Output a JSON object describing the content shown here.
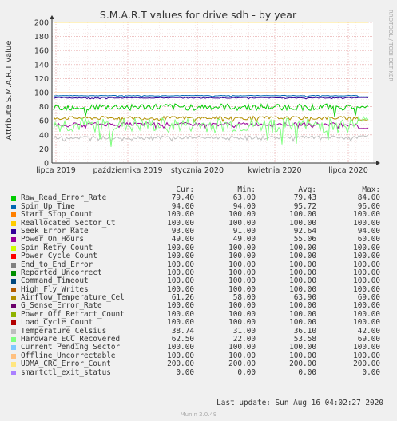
{
  "chart_data": {
    "type": "line",
    "title": "S.M.A.R.T values for drive sdh - by year",
    "ylabel": "Attribute S.M.A.R.T value",
    "side_label": "RRDTOOL / TOBI OETIKER",
    "ylim": [
      0,
      200
    ],
    "yticks": [
      "0",
      "20",
      "40",
      "60",
      "80",
      "100",
      "120",
      "140",
      "160",
      "180",
      "200"
    ],
    "xticks": [
      "lipca 2019",
      "października 2019",
      "stycznia 2020",
      "kwietnia 2020",
      "lipca 2020"
    ],
    "grid": true,
    "columns": [
      "Cur:",
      "Min:",
      "Avg:",
      "Max:"
    ],
    "series": [
      {
        "name": "Raw_Read_Error_Rate",
        "color": "#00cc00",
        "cur": "79.40",
        "min": "63.00",
        "avg": "79.43",
        "max": "84.00"
      },
      {
        "name": "Spin_Up_Time",
        "color": "#0066b3",
        "cur": "94.00",
        "min": "94.00",
        "avg": "95.72",
        "max": "96.00"
      },
      {
        "name": "Start_Stop_Count",
        "color": "#ff8000",
        "cur": "100.00",
        "min": "100.00",
        "avg": "100.00",
        "max": "100.00"
      },
      {
        "name": "Reallocated_Sector_Ct",
        "color": "#ffcc00",
        "cur": "100.00",
        "min": "100.00",
        "avg": "100.00",
        "max": "100.00"
      },
      {
        "name": "Seek_Error_Rate",
        "color": "#330099",
        "cur": "93.00",
        "min": "91.00",
        "avg": "92.64",
        "max": "94.00"
      },
      {
        "name": "Power_On_Hours",
        "color": "#990099",
        "cur": "49.00",
        "min": "49.00",
        "avg": "55.06",
        "max": "60.00"
      },
      {
        "name": "Spin_Retry_Count",
        "color": "#ccff00",
        "cur": "100.00",
        "min": "100.00",
        "avg": "100.00",
        "max": "100.00"
      },
      {
        "name": "Power_Cycle_Count",
        "color": "#ff0000",
        "cur": "100.00",
        "min": "100.00",
        "avg": "100.00",
        "max": "100.00"
      },
      {
        "name": "End_to_End_Error",
        "color": "#808080",
        "cur": "100.00",
        "min": "100.00",
        "avg": "100.00",
        "max": "100.00"
      },
      {
        "name": "Reported_Uncorrect",
        "color": "#008f00",
        "cur": "100.00",
        "min": "100.00",
        "avg": "100.00",
        "max": "100.00"
      },
      {
        "name": "Command_Timeout",
        "color": "#00487d",
        "cur": "100.00",
        "min": "100.00",
        "avg": "100.00",
        "max": "100.00"
      },
      {
        "name": "High_Fly_Writes",
        "color": "#b35a00",
        "cur": "100.00",
        "min": "100.00",
        "avg": "100.00",
        "max": "100.00"
      },
      {
        "name": "Airflow_Temperature_Cel",
        "color": "#b38f00",
        "cur": "61.26",
        "min": "58.00",
        "avg": "63.90",
        "max": "69.00"
      },
      {
        "name": "G_Sense_Error_Rate",
        "color": "#6b006b",
        "cur": "100.00",
        "min": "100.00",
        "avg": "100.00",
        "max": "100.00"
      },
      {
        "name": "Power_Off_Retract_Count",
        "color": "#8fb300",
        "cur": "100.00",
        "min": "100.00",
        "avg": "100.00",
        "max": "100.00"
      },
      {
        "name": "Load_Cycle_Count",
        "color": "#b30000",
        "cur": "100.00",
        "min": "100.00",
        "avg": "100.00",
        "max": "100.00"
      },
      {
        "name": "Temperature_Celsius",
        "color": "#bebebe",
        "cur": "38.74",
        "min": "31.00",
        "avg": "36.10",
        "max": "42.00"
      },
      {
        "name": "Hardware_ECC_Recovered",
        "color": "#80ff80",
        "cur": "62.50",
        "min": "22.00",
        "avg": "53.58",
        "max": "69.00"
      },
      {
        "name": "Current_Pending_Sector",
        "color": "#80c9ff",
        "cur": "100.00",
        "min": "100.00",
        "avg": "100.00",
        "max": "100.00"
      },
      {
        "name": "Offline_Uncorrectable",
        "color": "#ffc080",
        "cur": "100.00",
        "min": "100.00",
        "avg": "100.00",
        "max": "100.00"
      },
      {
        "name": "UDMA_CRC_Error_Count",
        "color": "#ffe680",
        "cur": "200.00",
        "min": "200.00",
        "avg": "200.00",
        "max": "200.00"
      },
      {
        "name": "smartctl_exit_status",
        "color": "#aa80ff",
        "cur": "0.00",
        "min": "0.00",
        "avg": "0.00",
        "max": "0.00"
      }
    ]
  },
  "last_update": "Last update: Sun Aug 16 04:02:27 2020",
  "footer": "Munin 2.0.49"
}
